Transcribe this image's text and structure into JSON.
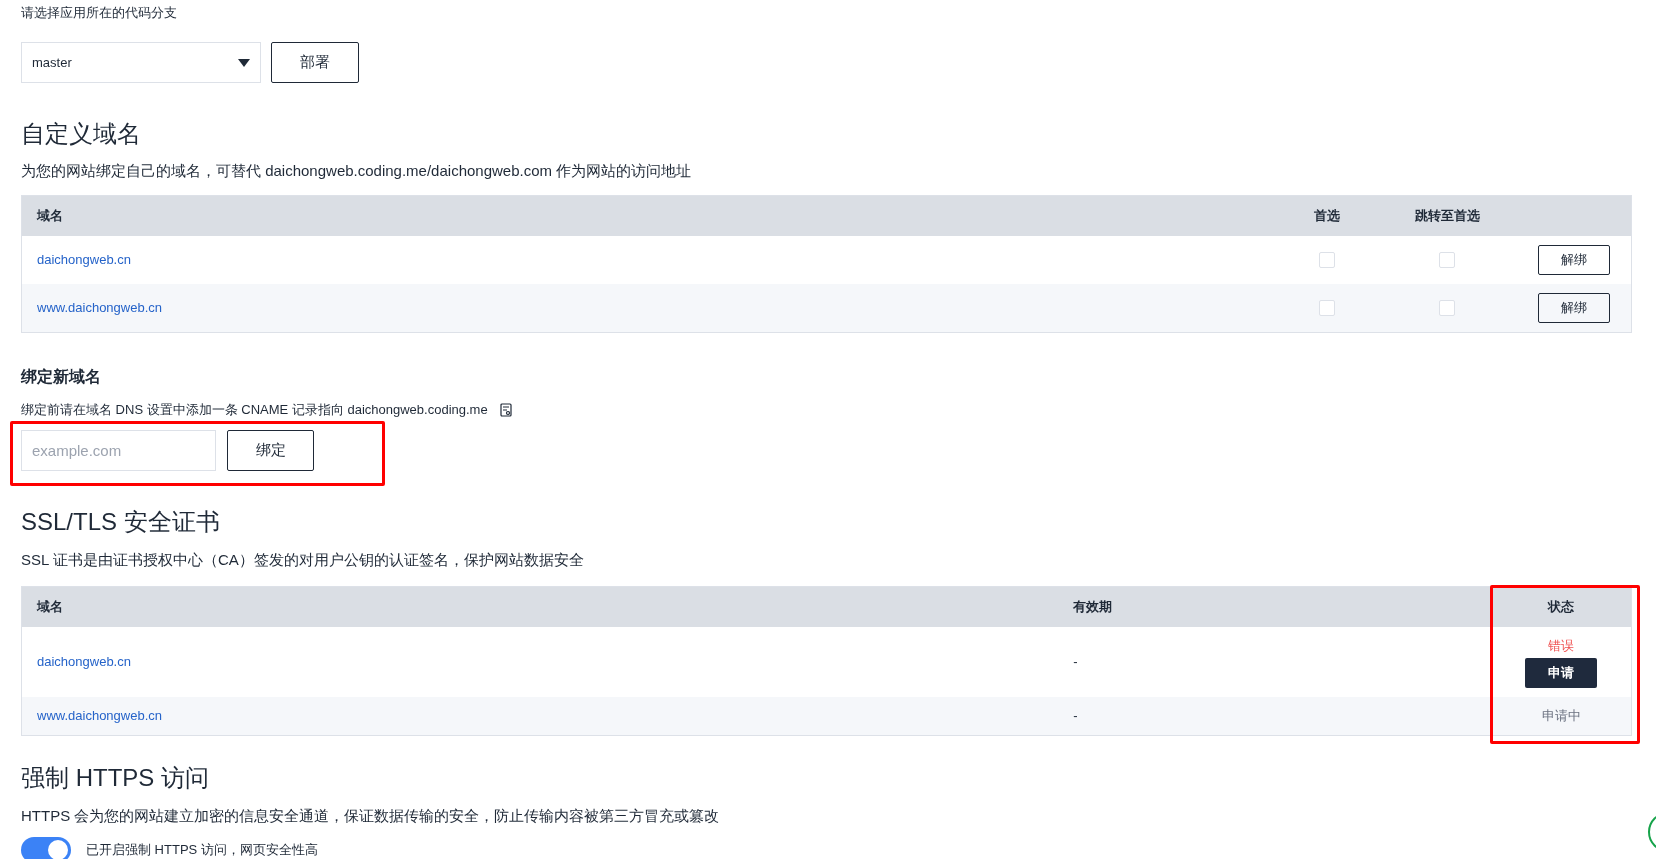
{
  "branch": {
    "label": "请选择应用所在的代码分支",
    "value": "master",
    "button": "部署"
  },
  "custom_domain": {
    "title": "自定义域名",
    "description": "为您的网站绑定自己的域名，可替代 daichongweb.coding.me/daichongweb.com 作为网站的访问地址",
    "columns": [
      "域名",
      "首选",
      "跳转至首选"
    ],
    "rows": [
      {
        "domain": "daichongweb.cn",
        "preferred": false,
        "redirect": false,
        "action": "解绑"
      },
      {
        "domain": "www.daichongweb.cn",
        "preferred": false,
        "redirect": false,
        "action": "解绑"
      }
    ]
  },
  "bind": {
    "title": "绑定新域名",
    "note": "绑定前请在域名 DNS 设置中添加一条 CNAME 记录指向 daichongweb.coding.me",
    "placeholder": "example.com",
    "button": "绑定"
  },
  "ssl": {
    "title": "SSL/TLS 安全证书",
    "description": "SSL 证书是由证书授权中心（CA）签发的对用户公钥的认证签名，保护网站数据安全",
    "columns": [
      "域名",
      "有效期",
      "状态"
    ],
    "rows": [
      {
        "domain": "daichongweb.cn",
        "validity": "-",
        "status": "错误",
        "color": "#f05454",
        "button": "申请"
      },
      {
        "domain": "www.daichongweb.cn",
        "validity": "-",
        "status": "申请中",
        "color": "#6b7280"
      }
    ]
  },
  "https": {
    "title": "强制 HTTPS 访问",
    "description": "HTTPS 会为您的网站建立加密的信息安全通道，保证数据传输的安全，防止传输内容被第三方冒充或篡改",
    "on": true,
    "label": "已开启强制 HTTPS 访问，网页安全性高"
  }
}
